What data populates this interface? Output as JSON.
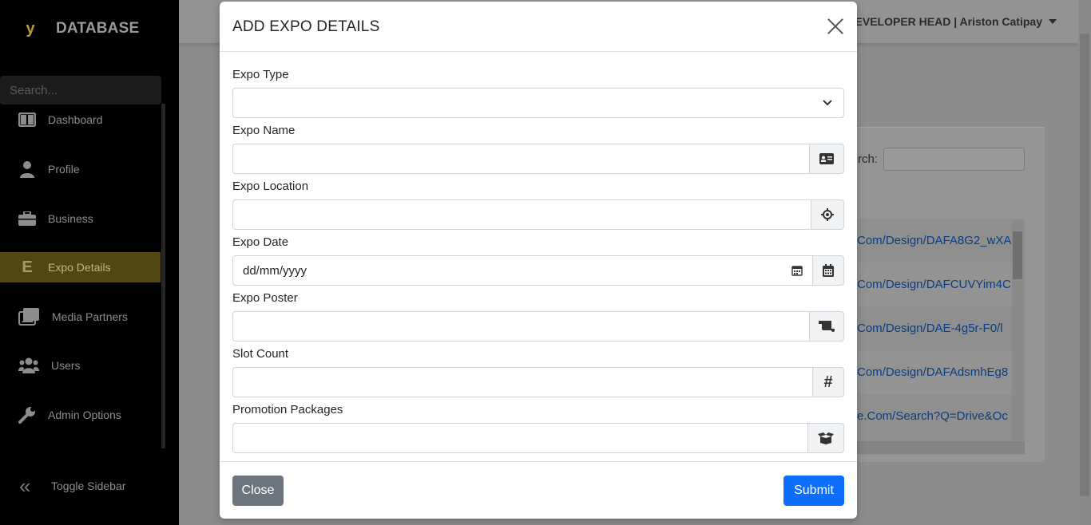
{
  "sidebar": {
    "brand": "DATABASE",
    "search_placeholder": "Search...",
    "items": [
      {
        "label": "Dashboard",
        "icon": "columns-icon"
      },
      {
        "label": "Profile",
        "icon": "user-icon"
      },
      {
        "label": "Business",
        "icon": "briefcase-icon"
      },
      {
        "label": "Expo Details",
        "icon": "letter-e-icon",
        "active": true
      },
      {
        "label": "Media Partners",
        "icon": "photos-icon"
      },
      {
        "label": "Users",
        "icon": "users-icon"
      },
      {
        "label": "Admin Options",
        "icon": "wrench-icon"
      }
    ],
    "toggle_label": "Toggle Sidebar"
  },
  "header": {
    "user": "DEVELOPER HEAD | Ariston Catipay"
  },
  "background_table": {
    "search_label": "rch:",
    "rows": [
      "Com/Design/DAFA8G2_wXA",
      "Com/Design/DAFCUVYim4C",
      "Com/Design/DAE-4g5r-F0/l",
      "Com/Design/DAFAdsmhEg8",
      "e.Com/Search?Q=Drive&Oc"
    ]
  },
  "modal": {
    "title": "ADD EXPO DETAILS",
    "fields": {
      "type_label": "Expo Type",
      "name_label": "Expo Name",
      "location_label": "Expo Location",
      "date_label": "Expo Date",
      "date_placeholder": "dd/mm/yyyy",
      "poster_label": "Expo Poster",
      "slot_label": "Slot Count",
      "slot_icon": "#",
      "promo_label": "Promotion Packages"
    },
    "close_label": "Close",
    "submit_label": "Submit"
  },
  "colors": {
    "sidebar_bg": "#000000",
    "active_item": "#524613",
    "primary": "#0d6efd",
    "secondary": "#6c757d"
  }
}
